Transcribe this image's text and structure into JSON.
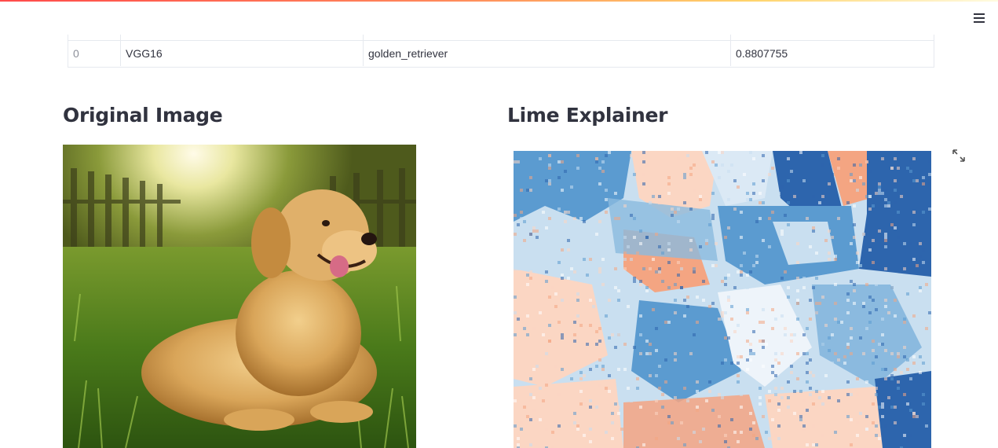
{
  "header": {
    "menu_icon": "hamburger-menu-icon"
  },
  "results_table": {
    "rows": [
      {
        "index": "0",
        "model": "VGG16",
        "label": "golden_retriever",
        "score": "0.8807755"
      }
    ]
  },
  "original_section": {
    "title": "Original Image",
    "image": "golden retriever lying in sunlit grass"
  },
  "lime_section": {
    "title": "Lime Explainer",
    "image": "LIME superpixel heatmap (blue/orange)",
    "expand_icon": "fullscreen-expand-icon"
  },
  "colors": {
    "accent_red": "#ff4b4b",
    "text": "#31333f",
    "lime_blue_dark": "#2d65ad",
    "lime_blue_mid": "#5b9bd0",
    "lime_blue_light": "#c9dff0",
    "lime_orange": "#f4a582",
    "lime_peach": "#fbd6c3"
  }
}
